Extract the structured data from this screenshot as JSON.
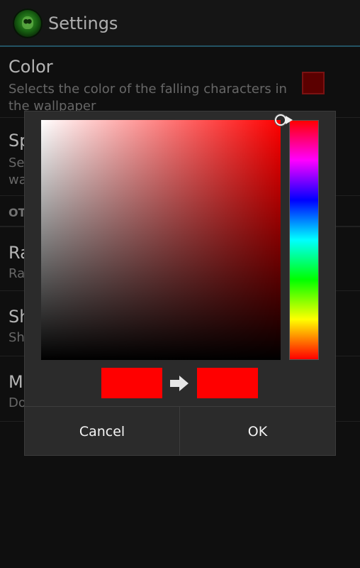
{
  "action_bar": {
    "title": "Settings",
    "icon": "matrix-skull-icon"
  },
  "preferences": [
    {
      "title": "Color",
      "summary": "Selects the color of the falling characters in the wallpaper"
    },
    {
      "title": "Sp",
      "summary": "Se\nwa"
    },
    {
      "category": "OT"
    },
    {
      "title": "Ra",
      "summary": "Ra"
    },
    {
      "title": "Sh",
      "summary": "Sh"
    },
    {
      "title": "Mo",
      "summary": "Do"
    }
  ],
  "color_dialog": {
    "current_color": "#ff0000",
    "new_color": "#ff0000",
    "hue_degrees": 0,
    "saturation": 1.0,
    "value": 1.0,
    "cancel_label": "Cancel",
    "ok_label": "OK"
  },
  "colors": {
    "preference_swatch": "#7a0000",
    "accent_line": "#2f6f85"
  }
}
